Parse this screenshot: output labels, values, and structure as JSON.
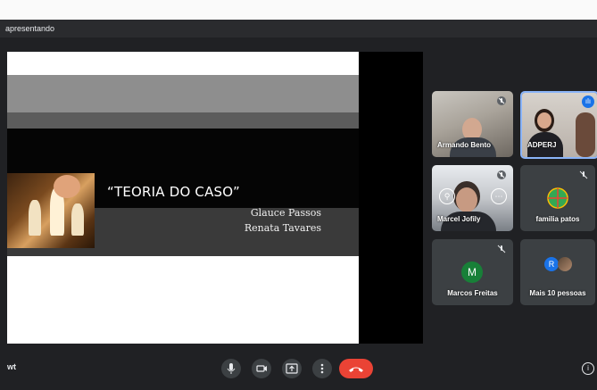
{
  "header": {
    "presenting_label": "apresentando"
  },
  "slide": {
    "title": "“TEORIA DO CASO”",
    "authors": [
      "Glauce Passos",
      "Renata Tavares"
    ]
  },
  "participants": [
    {
      "name": "Armando Bento"
    },
    {
      "name": "ADPERJ"
    },
    {
      "name": "Marcel Jofily"
    },
    {
      "name": "familia patos"
    },
    {
      "name": "Marcos Freitas",
      "initial": "M"
    },
    {
      "name": "Mais 10 pessoas",
      "initial": "R"
    }
  ],
  "bottom_bar": {
    "meeting_code_fragment": "wt"
  },
  "colors": {
    "accent": "#8ab4f8",
    "speaking": "#1a73e8",
    "leave": "#ea4335",
    "avatar_marcos": "#188038",
    "avatar_more": "#1a73e8"
  },
  "icons": {
    "mute": "mic-off-icon",
    "mic": "mic-icon",
    "camera": "camera-icon",
    "present": "present-icon",
    "more": "more-vert-icon",
    "leave": "call-end-icon",
    "info": "info-icon"
  }
}
